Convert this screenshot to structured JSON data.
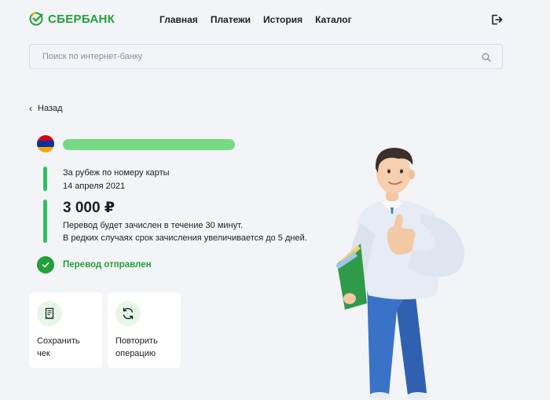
{
  "header": {
    "logo_text": "СБЕРБАНК",
    "nav": [
      "Главная",
      "Платежи",
      "История",
      "Каталог"
    ]
  },
  "search": {
    "placeholder": "Поиск по интернет-банку",
    "value": ""
  },
  "back": {
    "label": "Назад"
  },
  "recipient": {
    "flag_colors": [
      "#d90012",
      "#0033a0",
      "#f2a800"
    ]
  },
  "transfer": {
    "type": "За рубеж по номеру карты",
    "date": "14 апреля 2021",
    "amount": "3 000 ₽",
    "note_line1": "Перевод будет зачислен в течение 30 минут.",
    "note_line2": "В редких случаях срок зачисления увеличивается до 5 дней.",
    "status": "Перевод отправлен"
  },
  "actions": [
    {
      "label": "Сохранить\nчек",
      "icon": "receipt-icon"
    },
    {
      "label": "Повторить\nоперацию",
      "icon": "repeat-icon"
    }
  ],
  "colors": {
    "brand_green": "#21a038",
    "accent_green": "#2fbf5f",
    "background": "#f2f4f7"
  }
}
